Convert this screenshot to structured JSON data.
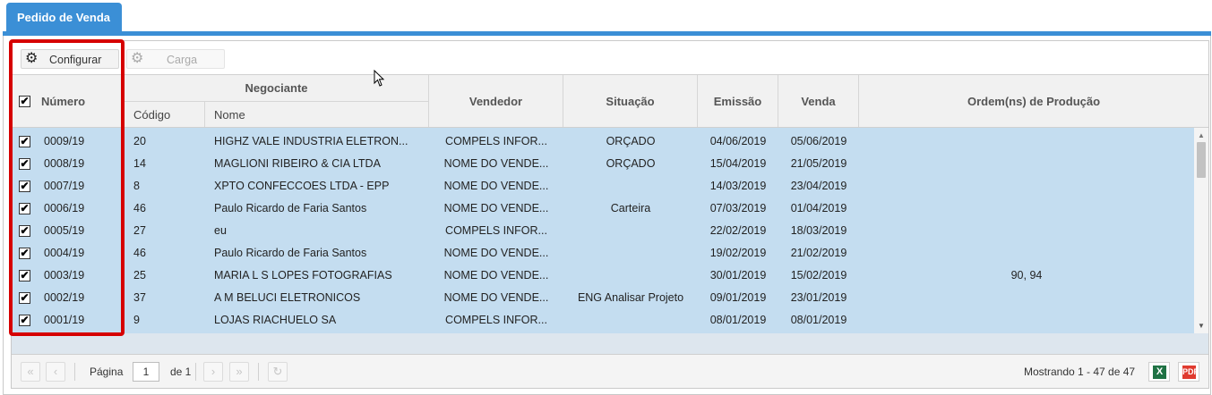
{
  "tab": {
    "label": "Pedido de Venda"
  },
  "toolbar": {
    "configurar_label": "Configurar",
    "carga_label": "Carga"
  },
  "columns": {
    "numero": "Número",
    "negociante": "Negociante",
    "codigo": "Código",
    "nome": "Nome",
    "vendedor": "Vendedor",
    "situacao": "Situação",
    "emissao": "Emissão",
    "venda": "Venda",
    "ordens": "Ordem(ns) de Produção"
  },
  "rows": [
    {
      "numero": "0009/19",
      "codigo": "20",
      "nome": "HIGHZ VALE INDUSTRIA ELETRON...",
      "vendedor": "COMPELS INFOR...",
      "situacao": "ORÇADO",
      "emissao": "04/06/2019",
      "venda": "05/06/2019",
      "ordens": ""
    },
    {
      "numero": "0008/19",
      "codigo": "14",
      "nome": "MAGLIONI RIBEIRO & CIA LTDA",
      "vendedor": "NOME DO VENDE...",
      "situacao": "ORÇADO",
      "emissao": "15/04/2019",
      "venda": "21/05/2019",
      "ordens": ""
    },
    {
      "numero": "0007/19",
      "codigo": "8",
      "nome": "XPTO CONFECCOES LTDA - EPP",
      "vendedor": "NOME DO VENDE...",
      "situacao": "",
      "emissao": "14/03/2019",
      "venda": "23/04/2019",
      "ordens": ""
    },
    {
      "numero": "0006/19",
      "codigo": "46",
      "nome": "Paulo Ricardo de Faria Santos",
      "vendedor": "NOME DO VENDE...",
      "situacao": "Carteira",
      "emissao": "07/03/2019",
      "venda": "01/04/2019",
      "ordens": ""
    },
    {
      "numero": "0005/19",
      "codigo": "27",
      "nome": "eu",
      "vendedor": "COMPELS INFOR...",
      "situacao": "",
      "emissao": "22/02/2019",
      "venda": "18/03/2019",
      "ordens": ""
    },
    {
      "numero": "0004/19",
      "codigo": "46",
      "nome": "Paulo Ricardo de Faria Santos",
      "vendedor": "NOME DO VENDE...",
      "situacao": "",
      "emissao": "19/02/2019",
      "venda": "21/02/2019",
      "ordens": ""
    },
    {
      "numero": "0003/19",
      "codigo": "25",
      "nome": "MARIA L S LOPES FOTOGRAFIAS",
      "vendedor": "NOME DO VENDE...",
      "situacao": "",
      "emissao": "30/01/2019",
      "venda": "15/02/2019",
      "ordens": "90, 94"
    },
    {
      "numero": "0002/19",
      "codigo": "37",
      "nome": "A M BELUCI ELETRONICOS",
      "vendedor": "NOME DO VENDE...",
      "situacao": "ENG Analisar Projeto",
      "emissao": "09/01/2019",
      "venda": "23/01/2019",
      "ordens": ""
    },
    {
      "numero": "0001/19",
      "codigo": "9",
      "nome": "LOJAS RIACHUELO SA",
      "vendedor": "COMPELS INFOR...",
      "situacao": "",
      "emissao": "08/01/2019",
      "venda": "08/01/2019",
      "ordens": ""
    }
  ],
  "pager": {
    "pagina_label": "Página",
    "page_value": "1",
    "de_label": "de 1",
    "summary": "Mostrando 1 - 47 de 47"
  },
  "colors": {
    "tab": "#3b8fd6",
    "selected_row": "#c4ddf0",
    "highlight": "#d60000"
  }
}
